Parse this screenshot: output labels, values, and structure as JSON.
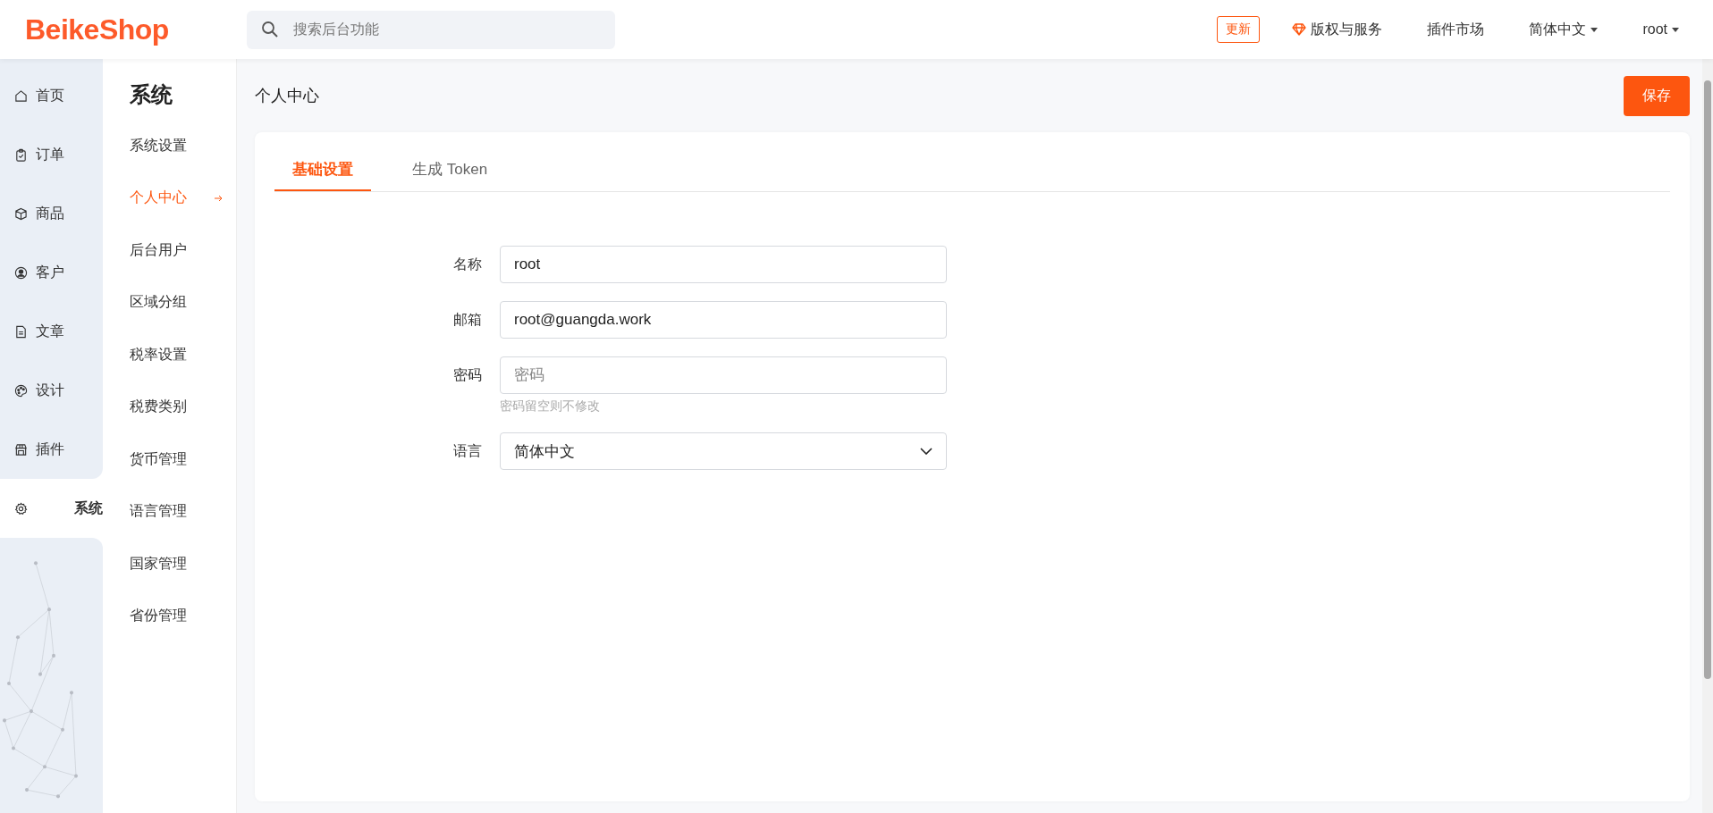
{
  "header": {
    "logo": "BeikeShop",
    "search": {
      "placeholder": "搜索后台功能"
    },
    "update_badge": "更新",
    "links": [
      {
        "kind": "gem",
        "label": "版权与服务"
      },
      {
        "kind": "plain",
        "label": "插件市场"
      },
      {
        "kind": "dropdown",
        "label": "简体中文"
      },
      {
        "kind": "dropdown",
        "label": "root"
      }
    ]
  },
  "nav": [
    {
      "label": "首页",
      "selected": false
    },
    {
      "label": "订单",
      "selected": false
    },
    {
      "label": "商品",
      "selected": false
    },
    {
      "label": "客户",
      "selected": false
    },
    {
      "label": "文章",
      "selected": false
    },
    {
      "label": "设计",
      "selected": false
    },
    {
      "label": "插件",
      "selected": false
    },
    {
      "label": "系统",
      "selected": true
    }
  ],
  "subnav": {
    "title": "系统",
    "items": [
      {
        "label": "系统设置",
        "selected": false
      },
      {
        "label": "个人中心",
        "selected": true
      },
      {
        "label": "后台用户",
        "selected": false
      },
      {
        "label": "区域分组",
        "selected": false
      },
      {
        "label": "税率设置",
        "selected": false
      },
      {
        "label": "税费类别",
        "selected": false
      },
      {
        "label": "货币管理",
        "selected": false
      },
      {
        "label": "语言管理",
        "selected": false
      },
      {
        "label": "国家管理",
        "selected": false
      },
      {
        "label": "省份管理",
        "selected": false
      }
    ]
  },
  "page": {
    "title": "个人中心",
    "save_button": "保存"
  },
  "tabs": [
    {
      "label": "基础设置",
      "selected": true
    },
    {
      "label": "生成 Token",
      "selected": false
    }
  ],
  "form": {
    "fields": [
      {
        "kind": "text",
        "label": "名称",
        "value": "root"
      },
      {
        "kind": "text",
        "label": "邮箱",
        "value": "root@guangda.work"
      },
      {
        "kind": "password",
        "label": "密码",
        "placeholder": "密码",
        "hint": "密码留空则不修改"
      },
      {
        "kind": "select",
        "label": "语言",
        "value": "简体中文"
      }
    ]
  }
}
